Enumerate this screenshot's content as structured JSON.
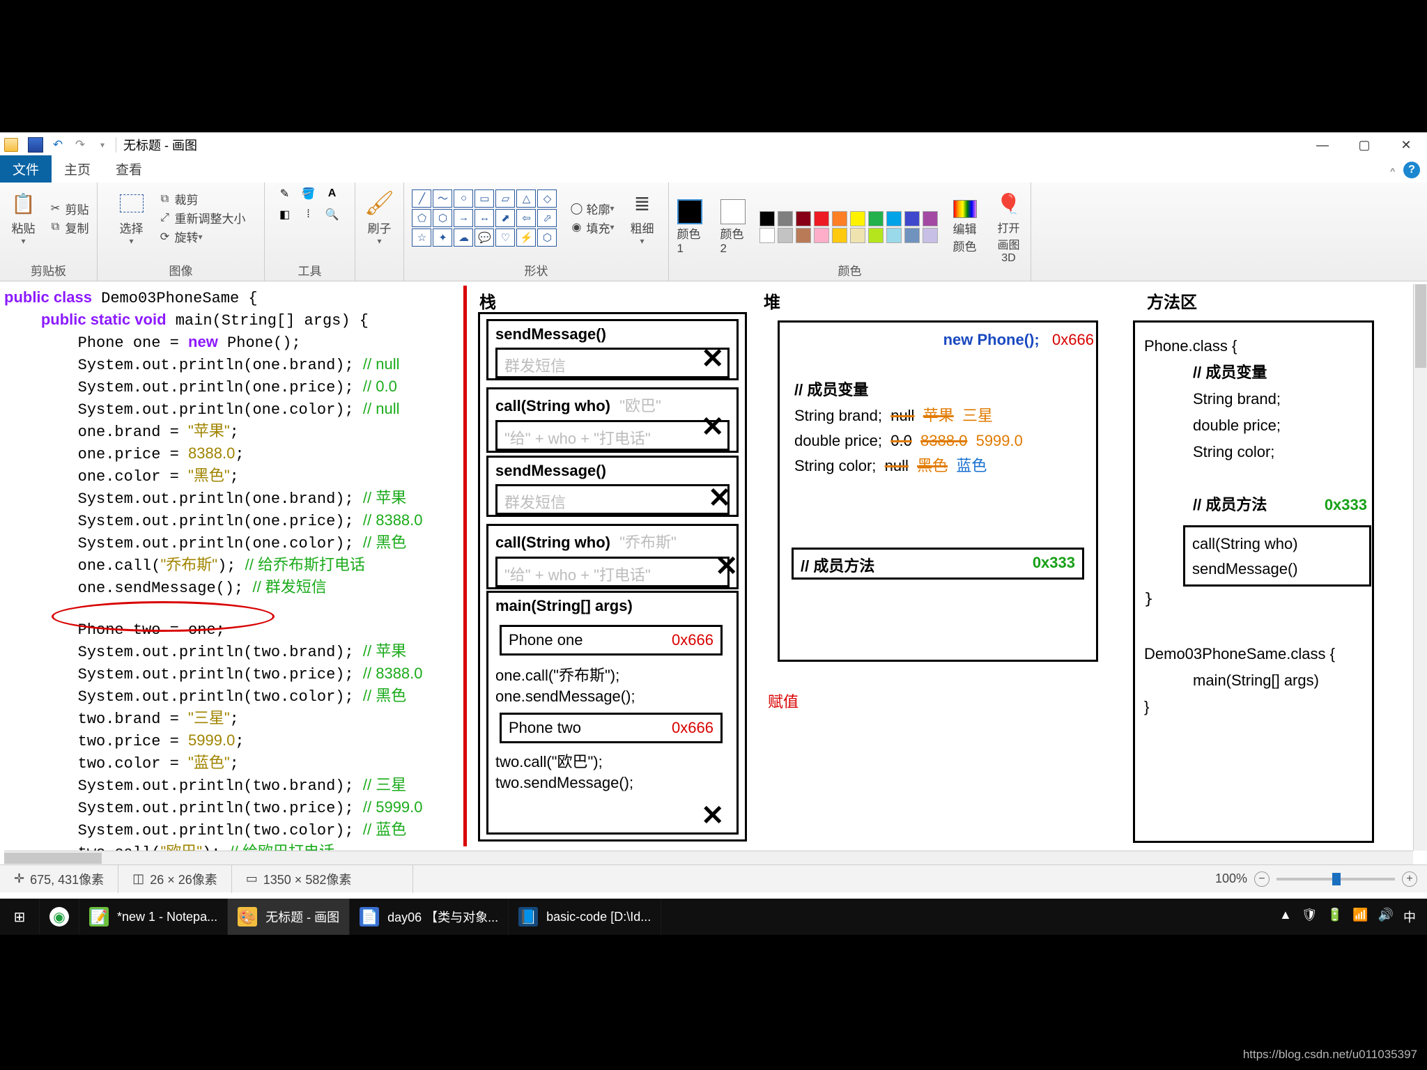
{
  "paint_window": {
    "title": "无标题 - 画图",
    "tabs": {
      "file": "文件",
      "home": "主页",
      "view": "查看"
    },
    "groups": {
      "clipboard": "剪贴板",
      "image": "图像",
      "tools": "工具",
      "shapes": "形状",
      "colors": "颜色"
    },
    "clipboard": {
      "paste": "粘贴",
      "cut": "剪贴",
      "copy": "复制"
    },
    "image": {
      "select": "选择",
      "crop": "裁剪",
      "resize": "重新调整大小",
      "rotate": "旋转"
    },
    "brush": "刷子",
    "outline": "轮廓",
    "fill": "填充",
    "thickness": "粗细",
    "color1": "颜色 1",
    "color2": "颜色 2",
    "edit_colors": "编辑颜色",
    "open_3d": "打开画图 3D",
    "palette": [
      "#000000",
      "#7f7f7f",
      "#880015",
      "#ed1c24",
      "#ff7f27",
      "#fff200",
      "#22b14c",
      "#00a2e8",
      "#3f48cc",
      "#a349a4",
      "#ffffff",
      "#c3c3c3",
      "#b97a57",
      "#ffaec9",
      "#ffc90e",
      "#efe4b0",
      "#b5e61d",
      "#99d9ea",
      "#7092be",
      "#c8bfe7"
    ],
    "color1_value": "#000000",
    "color2_value": "#ffffff"
  },
  "canvas": {
    "labels": {
      "stack": "栈",
      "heap": "堆",
      "method_area": "方法区",
      "assign": "赋值"
    },
    "code_lines": [
      "public class Demo03PhoneSame {",
      "    public static void main(String[] args) {",
      "        Phone one = new Phone();",
      "        System.out.println(one.brand); // null",
      "        System.out.println(one.price); // 0.0",
      "        System.out.println(one.color); // null",
      "        one.brand = \"苹果\";",
      "        one.price = 8388.0;",
      "        one.color = \"黑色\";",
      "        System.out.println(one.brand); // 苹果",
      "        System.out.println(one.price); // 8388.0",
      "        System.out.println(one.color); // 黑色",
      "        one.call(\"乔布斯\"); // 给乔布斯打电话",
      "        one.sendMessage(); // 群发短信",
      "",
      "        Phone two = one;",
      "        System.out.println(two.brand); // 苹果",
      "        System.out.println(two.price); // 8388.0",
      "        System.out.println(two.color); // 黑色",
      "        two.brand = \"三星\";",
      "        two.price = 5999.0;",
      "        two.color = \"蓝色\";",
      "        System.out.println(two.brand); // 三星",
      "        System.out.println(two.price); // 5999.0",
      "        System.out.println(two.color); // 蓝色",
      "        two.call(\"欧巴\"); // 给欧巴打电话"
    ],
    "stack": {
      "sendMessage1": "sendMessage()",
      "msg_body": "群发短信",
      "call1": "call(String who)",
      "call1_arg": "\"欧巴\"",
      "call_body": "\"给\" + who + \"打电话\"",
      "sendMessage2": "sendMessage()",
      "call2": "call(String who)",
      "call2_arg": "\"乔布斯\"",
      "main": "main(String[] args)",
      "phone_one": "Phone one",
      "phone_one_addr": "0x666",
      "one_call": "one.call(\"乔布斯\");",
      "one_send": "one.sendMessage();",
      "phone_two": "Phone two",
      "phone_two_addr": "0x666",
      "two_call": "two.call(\"欧巴\");",
      "two_send": "two.sendMessage();"
    },
    "heap": {
      "new_phone": "new Phone();",
      "new_phone_addr": "0x666",
      "member_var": "// 成员变量",
      "brand": "String brand;",
      "brand_v1": "null",
      "brand_v2": "苹果",
      "brand_v3": "三星",
      "price": "double price;",
      "price_v1": "0.0",
      "price_v2": "8388.0",
      "price_v3": "5999.0",
      "color": "String color;",
      "color_v1": "null",
      "color_v2": "黑色",
      "color_v3": "蓝色",
      "member_method": "// 成员方法",
      "method_addr": "0x333"
    },
    "method_area": {
      "phone_class": "Phone.class {",
      "mvar": "// 成员变量",
      "brand": "String brand;",
      "price": "double price;",
      "color": "String color;",
      "mmethod": "// 成员方法",
      "mmethod_addr": "0x333",
      "call": "call(String who)",
      "send": "sendMessage()",
      "close1": "}",
      "demo_class": "Demo03PhoneSame.class {",
      "demo_main": "main(String[] args)",
      "close2": "}"
    }
  },
  "statusbar": {
    "cursor": "675, 431像素",
    "selection": "26 × 26像素",
    "canvas_size": "1350 × 582像素",
    "zoom": "100%"
  },
  "taskbar": {
    "items": [
      {
        "icon": "⊞",
        "label": ""
      },
      {
        "icon": "🌐",
        "label": ""
      },
      {
        "icon": "📝",
        "label": "*new 1 - Notepa..."
      },
      {
        "icon": "🎨",
        "label": "无标题 - 画图"
      },
      {
        "icon": "📄",
        "label": "day06 【类与对象..."
      },
      {
        "icon": "📘",
        "label": "basic-code [D:\\Id..."
      }
    ],
    "tray": [
      "▲",
      "🛡",
      "🔋",
      "📶",
      "🔊",
      "中"
    ]
  },
  "watermark": "https://blog.csdn.net/u011035397"
}
